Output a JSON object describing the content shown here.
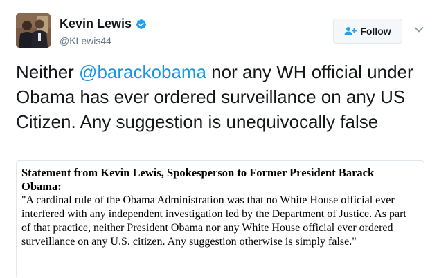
{
  "author": {
    "name": "Kevin Lewis",
    "handle": "@KLewis44",
    "verified": true,
    "avatar_description_icon": "profile-photo"
  },
  "actions": {
    "follow_label": "Follow",
    "menu_icon": "chevron-down-icon"
  },
  "tweet": {
    "text_before": "Neither ",
    "mention": "@barackobama",
    "text_after": " nor any WH official under Obama has ever ordered surveillance on any US Citizen. Any suggestion is unequivocally false"
  },
  "statement": {
    "title": "Statement from Kevin Lewis, Spokesperson to Former President Barack Obama:",
    "body": "\"A cardinal rule of the Obama Administration was that no White House official ever interfered with any independent investigation led by the Department of Justice. As part of that practice, neither President Obama nor any White House official ever ordered surveillance on any U.S. citizen. Any suggestion otherwise is simply false.\""
  },
  "colors": {
    "link": "#1b95e0",
    "verified_badge": "#1da1f2",
    "secondary_text": "#657786"
  }
}
